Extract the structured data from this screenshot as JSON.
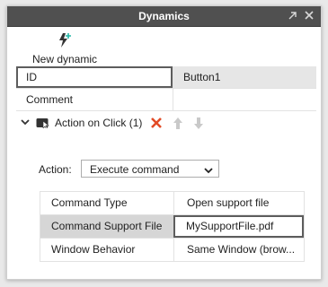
{
  "window": {
    "title": "Dynamics",
    "popout_icon": "popout-icon",
    "close_icon": "close-icon"
  },
  "toolbar": {
    "new_dynamic_label": "New dynamic",
    "new_dynamic_icon": "lightning-plus-icon"
  },
  "properties": [
    {
      "key": "ID",
      "value": "Button1"
    },
    {
      "key": "Comment",
      "value": ""
    }
  ],
  "action_section": {
    "title": "Action on Click (1)",
    "delete_icon": "delete-icon",
    "move_up_icon": "arrow-up-icon",
    "move_down_icon": "arrow-down-icon",
    "action_label": "Action:",
    "action_value": "Execute command",
    "params": [
      {
        "key": "Command Type",
        "value": "Open support file"
      },
      {
        "key": "Command Support File",
        "value": "MySupportFile.pdf"
      },
      {
        "key": "Window Behavior",
        "value": "Same Window (brow..."
      }
    ]
  },
  "colors": {
    "titlebar": "#505050",
    "delete": "#e24b26",
    "disabled_arrow": "#c9c9c9"
  }
}
